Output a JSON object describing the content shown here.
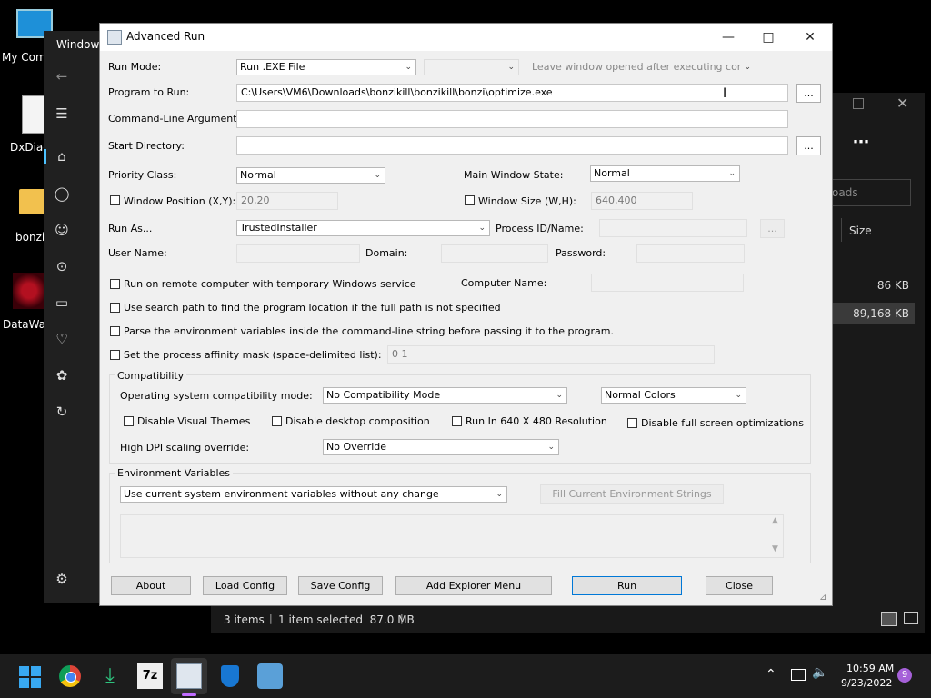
{
  "desktop": {
    "icons": [
      {
        "label": "My Com"
      },
      {
        "label": "DxDiag"
      },
      {
        "label": "bonzi"
      },
      {
        "label": "DataWag"
      }
    ]
  },
  "winsec": {
    "title": "Windows"
  },
  "explorer": {
    "search_placeholder": "oads",
    "col_size": "Size",
    "rows": [
      {
        "size": "86 KB"
      },
      {
        "size": "89,168 KB"
      }
    ],
    "status": {
      "items": "3 items",
      "selected": "1 item selected  87.0 MB"
    }
  },
  "advrun": {
    "title": "Advanced Run",
    "run_mode_label": "Run Mode:",
    "run_mode_value": "Run .EXE File",
    "leave_window_value": "Leave window opened after executing command",
    "program_label": "Program to Run:",
    "program_value": "C:\\Users\\VM6\\Downloads\\bonzikill\\bonzikill\\bonzi\\optimize.exe",
    "browse": "...",
    "cmdline_label": "Command-Line Arguments:",
    "startdir_label": "Start Directory:",
    "priority_label": "Priority Class:",
    "priority_value": "Normal",
    "mainwin_label": "Main Window State:",
    "mainwin_value": "Normal",
    "winpos_label": "Window Position (X,Y):",
    "winpos_value": "20,20",
    "winsize_label": "Window Size (W,H):",
    "winsize_value": "640,400",
    "runas_label": "Run As...",
    "runas_value": "TrustedInstaller",
    "pid_label": "Process ID/Name:",
    "username_label": "User Name:",
    "domain_label": "Domain:",
    "password_label": "Password:",
    "remote_label": "Run on remote computer with temporary Windows service",
    "computer_label": "Computer Name:",
    "searchpath_label": "Use search path to find the program location if the full path is not specified",
    "parseenv_label": "Parse the environment variables inside the command-line string before passing it to the program.",
    "affinity_label": "Set the process affinity mask (space-delimited list):",
    "affinity_value": "0 1",
    "compat": {
      "title": "Compatibility",
      "os_label": "Operating system compatibility mode:",
      "os_value": "No Compatibility Mode",
      "colors_value": "Normal Colors",
      "visual_themes": "Disable Visual Themes",
      "desktop_comp": "Disable desktop composition",
      "res640": "Run In 640 X 480 Resolution",
      "fullscreen": "Disable full screen optimizations",
      "dpi_label": "High DPI scaling override:",
      "dpi_value": "No Override"
    },
    "env": {
      "title": "Environment Variables",
      "mode_value": "Use current system environment variables without any change",
      "fill_button": "Fill Current Environment Strings"
    },
    "buttons": {
      "about": "About",
      "load": "Load Config",
      "save": "Save Config",
      "explorer": "Add Explorer Menu",
      "run": "Run",
      "close": "Close"
    }
  },
  "taskbar": {
    "time": "10:59 AM",
    "date": "9/23/2022",
    "badge": "9"
  },
  "colors": {
    "accent": "#0078d7",
    "taskbar": "#1c1c1c"
  }
}
